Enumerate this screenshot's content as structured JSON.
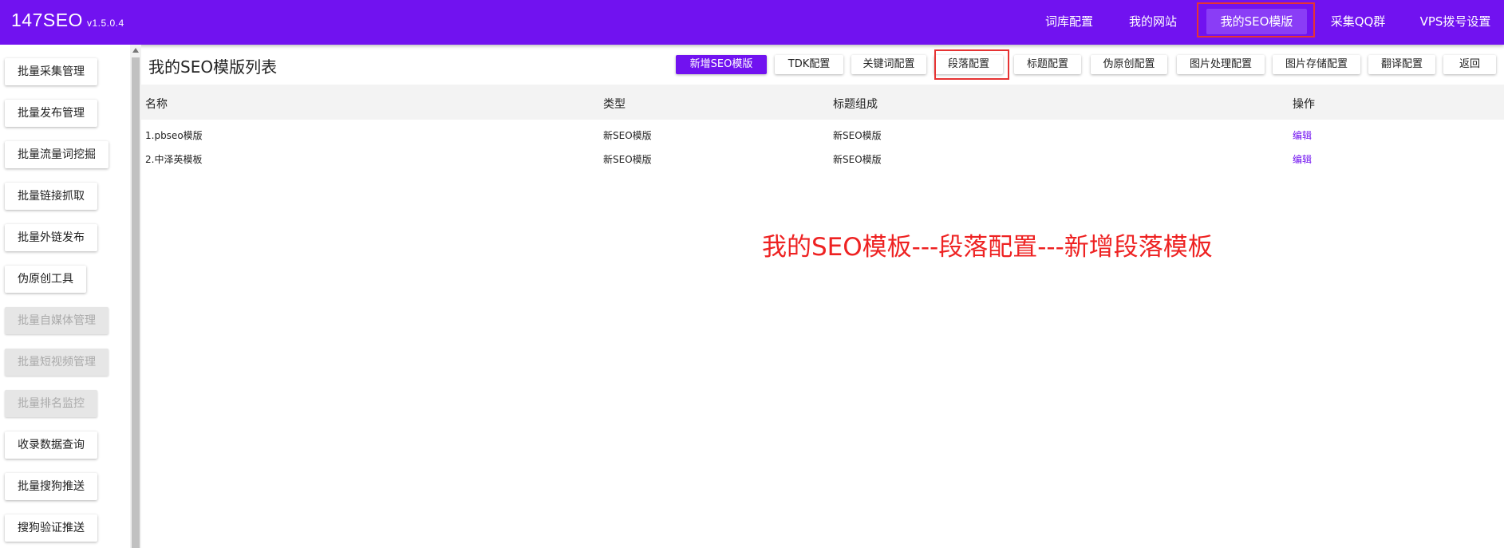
{
  "brand": {
    "name": "147SEO",
    "version": "v1.5.0.4"
  },
  "header_nav": [
    {
      "label": "词库配置"
    },
    {
      "label": "我的网站"
    },
    {
      "label": "我的SEO模版",
      "active": true
    },
    {
      "label": "采集QQ群"
    },
    {
      "label": "VPS拨号设置"
    }
  ],
  "sidebar": {
    "items": [
      {
        "label": "批量采集管理",
        "disabled": false
      },
      {
        "label": "批量发布管理",
        "disabled": false
      },
      {
        "label": "批量流量词挖掘",
        "disabled": false
      },
      {
        "label": "批量链接抓取",
        "disabled": false
      },
      {
        "label": "批量外链发布",
        "disabled": false
      },
      {
        "label": "伪原创工具",
        "disabled": false
      },
      {
        "label": "批量自媒体管理",
        "disabled": true
      },
      {
        "label": "批量短视频管理",
        "disabled": true
      },
      {
        "label": "批量排名监控",
        "disabled": true
      },
      {
        "label": "收录数据查询",
        "disabled": false
      },
      {
        "label": "批量搜狗推送",
        "disabled": false
      },
      {
        "label": "搜狗验证推送",
        "disabled": false
      }
    ]
  },
  "main": {
    "title": "我的SEO模版列表",
    "toolbar": [
      {
        "label": "新增SEO模版",
        "primary": true
      },
      {
        "label": "TDK配置"
      },
      {
        "label": "关键词配置"
      },
      {
        "label": "段落配置"
      },
      {
        "label": "标题配置"
      },
      {
        "label": "伪原创配置"
      },
      {
        "label": "图片处理配置"
      },
      {
        "label": "图片存储配置"
      },
      {
        "label": "翻译配置"
      },
      {
        "label": "返回"
      }
    ],
    "table": {
      "columns": [
        "名称",
        "类型",
        "标题组成",
        "操作"
      ],
      "rows": [
        {
          "name": "1.pbseo模版",
          "type": "新SEO模版",
          "title_composition": "新SEO模版",
          "action": "编辑"
        },
        {
          "name": "2.中泽英模板",
          "type": "新SEO模版",
          "title_composition": "新SEO模版",
          "action": "编辑"
        }
      ]
    }
  },
  "annotation": "我的SEO模板---段落配置---新增段落模板",
  "colors": {
    "brand": "#7112f0",
    "annotation": "#ee2222",
    "highlight_box": "#e63333"
  }
}
